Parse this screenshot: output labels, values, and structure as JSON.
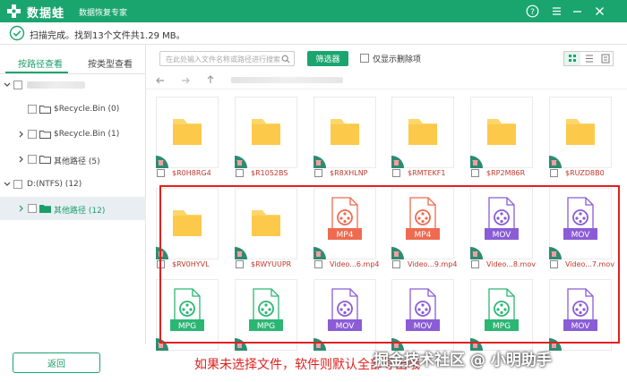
{
  "titlebar": {
    "app_name": "数据蛙",
    "subtitle": "数据恢复专家",
    "accent": "#1aa56f"
  },
  "status": {
    "text": "扫描完成。找到13个文件共1.29 MB。"
  },
  "sidebar": {
    "tabs": [
      {
        "label": "按路径查看",
        "active": true
      },
      {
        "label": "按类型查看",
        "active": false
      }
    ],
    "tree": [
      {
        "label": "",
        "expanded": true,
        "indent": 0
      },
      {
        "label": "$Recycle.Bin (0)",
        "expanded": false,
        "indent": 1
      },
      {
        "label": "$Recycle.Bin (1)",
        "expanded": false,
        "indent": 1
      },
      {
        "label": "其他路径 (5)",
        "expanded": false,
        "indent": 1
      },
      {
        "label": "D:(NTFS) (12)",
        "expanded": true,
        "indent": 0
      },
      {
        "label": "其他路径 (12)",
        "expanded": false,
        "indent": 1,
        "selected": true
      }
    ],
    "back_label": "返回"
  },
  "toolbar": {
    "search_placeholder": "在此处输入文件名称或路径进行搜索",
    "filter_label": "筛选器",
    "only_deleted_label": "仅显示删除项"
  },
  "files": [
    {
      "name": "$R0H8RG4",
      "type": "folder"
    },
    {
      "name": "$R1052BS",
      "type": "folder"
    },
    {
      "name": "$R8XHLNP",
      "type": "folder"
    },
    {
      "name": "$RMTEKF1",
      "type": "folder"
    },
    {
      "name": "$RP2M86R",
      "type": "folder"
    },
    {
      "name": "$RUZD8B0",
      "type": "folder"
    },
    {
      "name": "$RV0HYVL",
      "type": "folder"
    },
    {
      "name": "$RWYUUPR",
      "type": "folder"
    },
    {
      "name": "Video...6.mp4",
      "type": "video",
      "ext": "MP4",
      "color": "#ef6b50"
    },
    {
      "name": "Video...9.mp4",
      "type": "video",
      "ext": "MP4",
      "color": "#ef6b50"
    },
    {
      "name": "Video...8.mov",
      "type": "video",
      "ext": "MOV",
      "color": "#8a5cd6"
    },
    {
      "name": "Video...7.mov",
      "type": "video",
      "ext": "MOV",
      "color": "#8a5cd6"
    },
    {
      "name": "",
      "type": "video",
      "ext": "MPG",
      "color": "#2bb673"
    },
    {
      "name": "",
      "type": "video",
      "ext": "MPG",
      "color": "#2bb673"
    },
    {
      "name": "",
      "type": "video",
      "ext": "MOV",
      "color": "#8a5cd6"
    },
    {
      "name": "",
      "type": "video",
      "ext": "MOV",
      "color": "#8a5cd6"
    },
    {
      "name": "",
      "type": "video",
      "ext": "MPG",
      "color": "#2bb673"
    },
    {
      "name": "",
      "type": "video",
      "ext": "MOV",
      "color": "#8a5cd6"
    }
  ],
  "annotation": {
    "caption": "如果未选择文件，软件则默认全部导出哦",
    "watermark": "掘金技术社区 @ 小明助手",
    "color": "#e02020"
  }
}
